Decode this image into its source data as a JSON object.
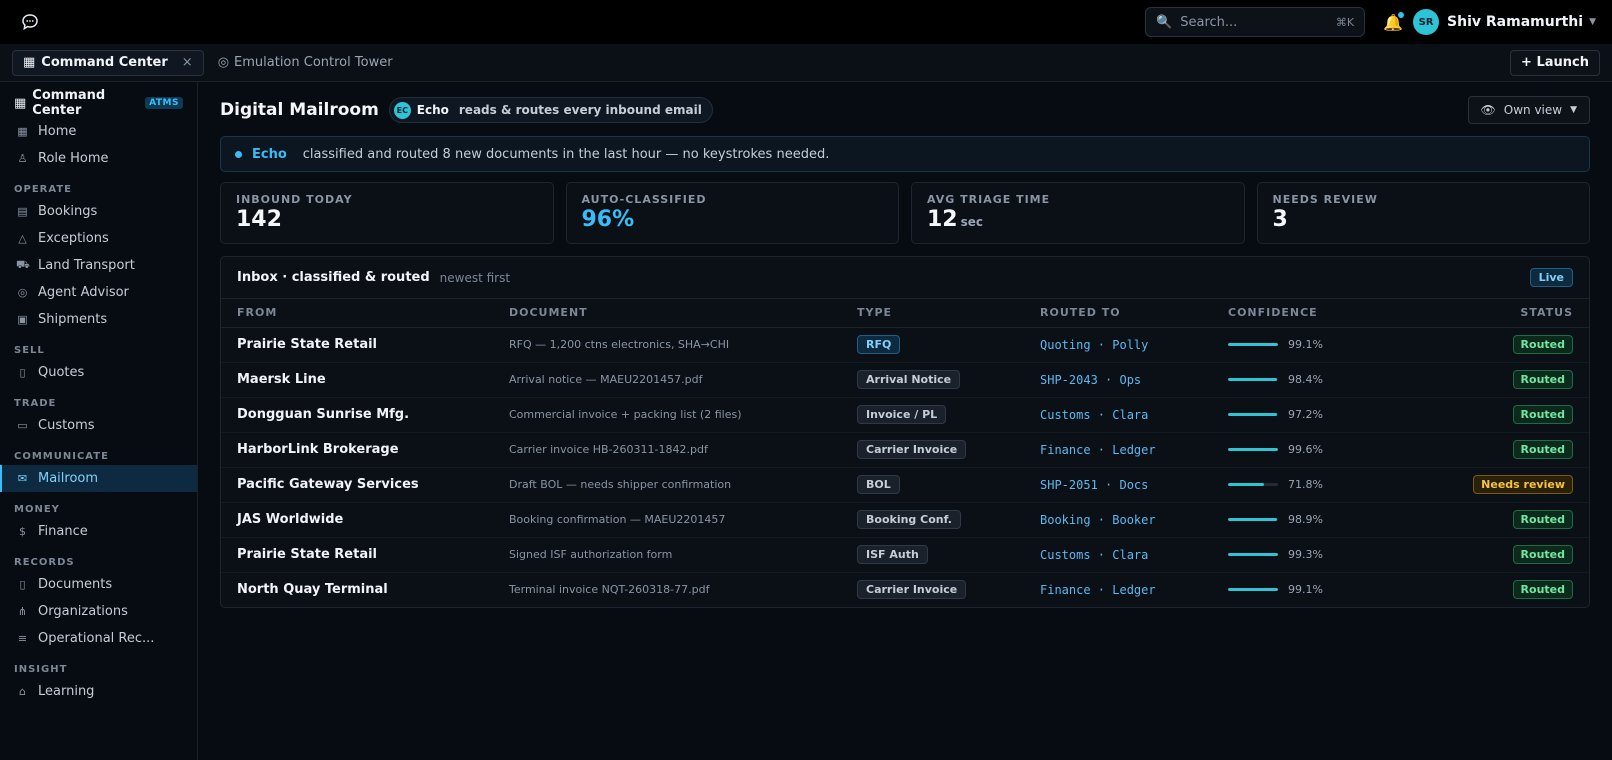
{
  "topbar": {
    "app_icon": "chat-bubble-icon",
    "search_placeholder": "Search...",
    "search_shortcut": "⌘K",
    "user_initials": "SR",
    "user_name": "Shiv Ramamurthi"
  },
  "tabs": {
    "active_label": "Command Center",
    "secondary_label": "Emulation Control Tower",
    "launch_label": "+ Launch"
  },
  "sidebar": {
    "title": "Command Center",
    "badge": "ATMS",
    "items_top": [
      {
        "label": "Home",
        "icon": "grid-icon"
      },
      {
        "label": "Role Home",
        "icon": "person-icon"
      }
    ],
    "sections": [
      {
        "name": "OPERATE",
        "items": [
          {
            "label": "Bookings",
            "icon": "calendar-icon"
          },
          {
            "label": "Exceptions",
            "icon": "warning-icon"
          },
          {
            "label": "Land Transport",
            "icon": "truck-icon"
          },
          {
            "label": "Agent Advisor",
            "icon": "robot-icon"
          },
          {
            "label": "Shipments",
            "icon": "box-icon"
          }
        ]
      },
      {
        "name": "SELL",
        "items": [
          {
            "label": "Quotes",
            "icon": "document-icon"
          }
        ]
      },
      {
        "name": "TRADE",
        "items": [
          {
            "label": "Customs",
            "icon": "briefcase-icon"
          }
        ]
      },
      {
        "name": "COMMUNICATE",
        "items": [
          {
            "label": "Mailroom",
            "icon": "mail-icon",
            "active": true
          }
        ]
      },
      {
        "name": "MONEY",
        "items": [
          {
            "label": "Finance",
            "icon": "dollar-icon"
          }
        ]
      },
      {
        "name": "RECORDS",
        "items": [
          {
            "label": "Documents",
            "icon": "file-icon"
          },
          {
            "label": "Organizations",
            "icon": "network-icon"
          },
          {
            "label": "Operational Rec...",
            "icon": "list-icon"
          }
        ]
      },
      {
        "name": "INSIGHT",
        "items": [
          {
            "label": "Learning",
            "icon": "graduation-cap-icon"
          }
        ]
      }
    ]
  },
  "page": {
    "title": "Digital Mailroom",
    "agent_initials": "EC",
    "agent_name": "Echo",
    "agent_desc": "reads & routes every inbound email",
    "view_label": "Own view"
  },
  "banner": {
    "who": "Echo",
    "message": "classified and routed 8 new documents in the last hour — no keystrokes needed."
  },
  "stats": [
    {
      "label": "INBOUND TODAY",
      "value": "142",
      "unit": ""
    },
    {
      "label": "AUTO-CLASSIFIED",
      "value": "96%",
      "unit": ""
    },
    {
      "label": "AVG TRIAGE TIME",
      "value": "12",
      "unit": "sec"
    },
    {
      "label": "NEEDS REVIEW",
      "value": "3",
      "unit": ""
    }
  ],
  "inbox": {
    "title": "Inbox · classified & routed",
    "subtitle": "newest first",
    "live_label": "Live",
    "columns": [
      "FROM",
      "DOCUMENT",
      "TYPE",
      "ROUTED TO",
      "CONFIDENCE",
      "STATUS"
    ],
    "rows": [
      {
        "from": "Prairie State Retail",
        "document": "RFQ — 1,200 ctns electronics, SHA→CHI",
        "type": "RFQ",
        "routed_to": "Quoting · Polly",
        "confidence": 99.1,
        "confidence_label": "99.1%",
        "status": "Routed"
      },
      {
        "from": "Maersk Line",
        "document": "Arrival notice — MAEU2201457.pdf",
        "type": "Arrival Notice",
        "routed_to": "SHP-2043 · Ops",
        "confidence": 98.4,
        "confidence_label": "98.4%",
        "status": "Routed"
      },
      {
        "from": "Dongguan Sunrise Mfg.",
        "document": "Commercial invoice + packing list (2 files)",
        "type": "Invoice / PL",
        "routed_to": "Customs · Clara",
        "confidence": 97.2,
        "confidence_label": "97.2%",
        "status": "Routed"
      },
      {
        "from": "HarborLink Brokerage",
        "document": "Carrier invoice HB-260311-1842.pdf",
        "type": "Carrier Invoice",
        "routed_to": "Finance · Ledger",
        "confidence": 99.6,
        "confidence_label": "99.6%",
        "status": "Routed"
      },
      {
        "from": "Pacific Gateway Services",
        "document": "Draft BOL — needs shipper confirmation",
        "type": "BOL",
        "routed_to": "SHP-2051 · Docs",
        "confidence": 71.8,
        "confidence_label": "71.8%",
        "status": "Needs review"
      },
      {
        "from": "JAS Worldwide",
        "document": "Booking confirmation — MAEU2201457",
        "type": "Booking Conf.",
        "routed_to": "Booking · Booker",
        "confidence": 98.9,
        "confidence_label": "98.9%",
        "status": "Routed"
      },
      {
        "from": "Prairie State Retail",
        "document": "Signed ISF authorization form",
        "type": "ISF Auth",
        "routed_to": "Customs · Clara",
        "confidence": 99.3,
        "confidence_label": "99.3%",
        "status": "Routed"
      },
      {
        "from": "North Quay Terminal",
        "document": "Terminal invoice NQT-260318-77.pdf",
        "type": "Carrier Invoice",
        "routed_to": "Finance · Ledger",
        "confidence": 99.1,
        "confidence_label": "99.1%",
        "status": "Routed"
      }
    ]
  },
  "colors": {
    "accent": "#38bdf8",
    "routed": "#6ee7a0",
    "review": "#f6c343",
    "bar": "#2ec4d6"
  }
}
